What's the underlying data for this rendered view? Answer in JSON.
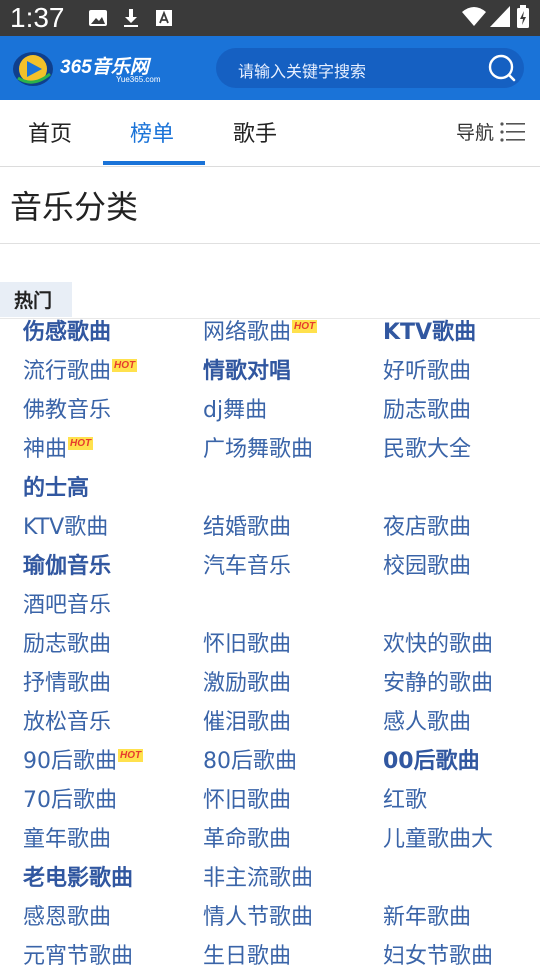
{
  "status": {
    "time": "1:37"
  },
  "header": {
    "logo_text": "365音乐网",
    "logo_sub": "Yue365.com",
    "search_placeholder": "请输入关键字搜索"
  },
  "tabs": [
    {
      "label": "首页"
    },
    {
      "label": "榜单"
    },
    {
      "label": "歌手"
    }
  ],
  "nav_label": "导航",
  "section_title": "音乐分类",
  "hot_label": "热门",
  "hot_badge": "HOT",
  "rows": [
    [
      {
        "t": "伤感歌曲",
        "b": true
      },
      {
        "t": "网络歌曲",
        "hot": true
      },
      {
        "t": "KTV歌曲",
        "b": true
      }
    ],
    [
      {
        "t": "流行歌曲",
        "hot": true
      },
      {
        "t": "情歌对唱",
        "b": true
      },
      {
        "t": "好听歌曲"
      }
    ],
    [
      {
        "t": "佛教音乐"
      },
      {
        "t": "dj舞曲"
      },
      {
        "t": "励志歌曲"
      }
    ],
    [
      {
        "t": "神曲",
        "hot": true
      },
      {
        "t": "广场舞歌曲"
      },
      {
        "t": "民歌大全"
      }
    ],
    [
      {
        "t": "的士高",
        "b": true
      }
    ],
    [
      {
        "t": "KTV歌曲"
      },
      {
        "t": "结婚歌曲"
      },
      {
        "t": "夜店歌曲"
      }
    ],
    [
      {
        "t": "瑜伽音乐",
        "b": true
      },
      {
        "t": "汽车音乐"
      },
      {
        "t": "校园歌曲"
      }
    ],
    [
      {
        "t": "酒吧音乐"
      }
    ],
    [
      {
        "t": "励志歌曲"
      },
      {
        "t": "怀旧歌曲"
      },
      {
        "t": "欢快的歌曲"
      }
    ],
    [
      {
        "t": "抒情歌曲"
      },
      {
        "t": "激励歌曲"
      },
      {
        "t": "安静的歌曲"
      }
    ],
    [
      {
        "t": "放松音乐"
      },
      {
        "t": "催泪歌曲"
      },
      {
        "t": "感人歌曲"
      }
    ],
    [
      {
        "t": "90后歌曲",
        "hot": true
      },
      {
        "t": "80后歌曲"
      },
      {
        "t": "00后歌曲",
        "b": true
      }
    ],
    [
      {
        "t": "70后歌曲"
      },
      {
        "t": "怀旧歌曲"
      },
      {
        "t": "红歌"
      }
    ],
    [
      {
        "t": "童年歌曲"
      },
      {
        "t": "革命歌曲"
      },
      {
        "t": "儿童歌曲大"
      }
    ],
    [
      {
        "t": "老电影歌曲",
        "b": true
      },
      {
        "t": "非主流歌曲"
      }
    ],
    [
      {
        "t": "感恩歌曲"
      },
      {
        "t": "情人节歌曲"
      },
      {
        "t": "新年歌曲"
      }
    ],
    [
      {
        "t": "元宵节歌曲"
      },
      {
        "t": "生日歌曲"
      },
      {
        "t": "妇女节歌曲"
      }
    ]
  ]
}
